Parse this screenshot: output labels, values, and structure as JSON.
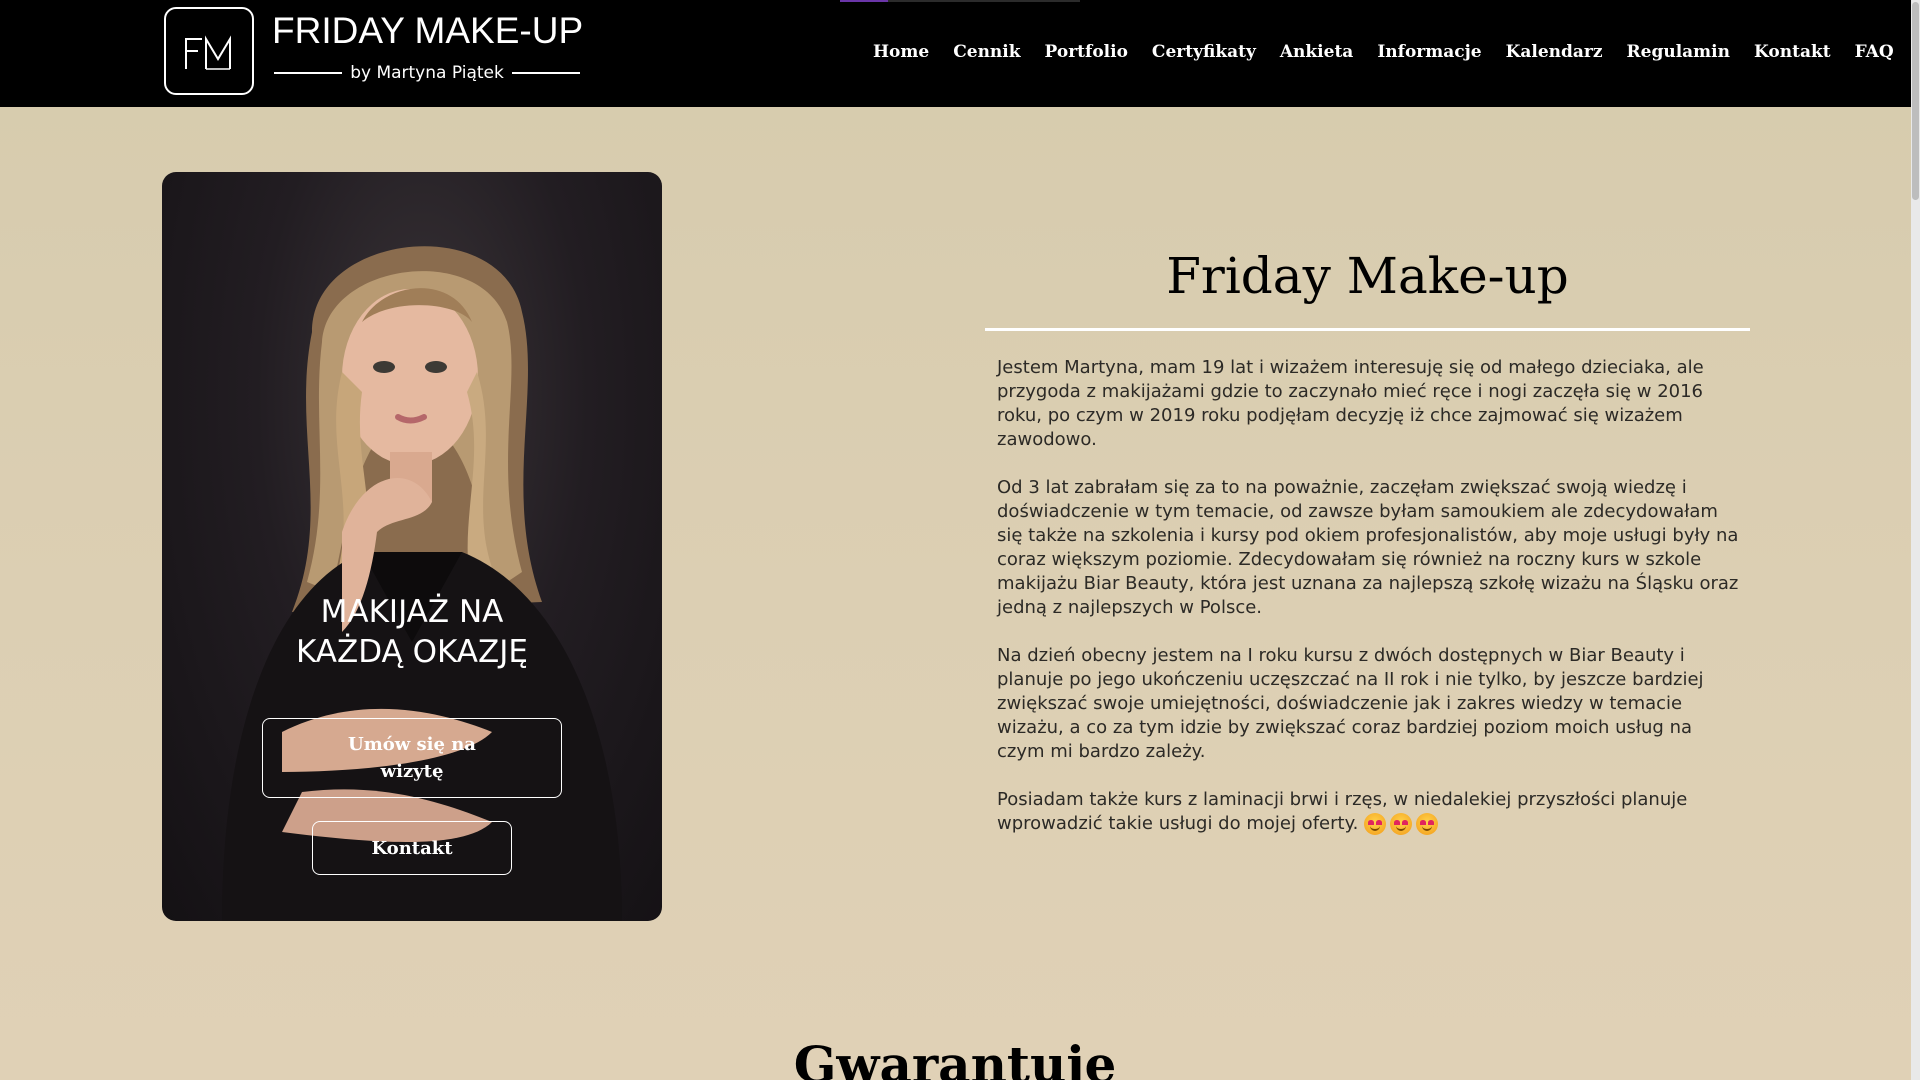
{
  "header": {
    "logo_letters": "FM",
    "brand_title": "FRIDAY MAKE-UP",
    "brand_subtitle": "by Martyna Piątek",
    "nav": [
      {
        "label": "Home"
      },
      {
        "label": "Cennik"
      },
      {
        "label": "Portfolio"
      },
      {
        "label": "Certyfikaty"
      },
      {
        "label": "Ankieta"
      },
      {
        "label": "Informacje"
      },
      {
        "label": "Kalendarz"
      },
      {
        "label": "Regulamin"
      },
      {
        "label": "Kontakt"
      },
      {
        "label": "FAQ"
      }
    ]
  },
  "hero": {
    "heading_line1": "MAKIJAŻ NA",
    "heading_line2": "KAŻDĄ OKAZJĘ",
    "appointment_button": "Umów się na wizytę",
    "contact_button": "Kontakt"
  },
  "about": {
    "title": "Friday Make-up",
    "paragraphs": [
      "Jestem Martyna, mam 19 lat i wizażem interesuję się od małego dzieciaka, ale przygoda z makijażami gdzie to zaczynało mieć ręce i nogi zaczęła się w 2016 roku, po czym w 2019 roku podjęłam decyzję iż chce zajmować się wizażem zawodowo.",
      "Od 3 lat zabrałam się za to na poważnie, zaczęłam zwiększać swoją wiedzę i doświadczenie w tym temacie, od zawsze byłam samoukiem ale zdecydowałam się także na szkolenia i kursy pod okiem profesjonalistów, aby moje usługi były na coraz większym poziomie. Zdecydowałam się również na roczny kurs w szkole makijażu Biar Beauty, która jest uznana za najlepszą szkołę wizażu na Śląsku oraz jedną z najlepszych w Polsce.",
      "Na dzień obecny jestem na I roku kursu z dwóch dostępnych w Biar Beauty i planuje po jego ukończeniu uczęszczać na II rok i nie tylko, by jeszcze bardziej zwiększać swoje umiejętności, doświadczenie jak i zakres wiedzy w temacie wizażu, a co za tym idzie by zwiększać coraz bardziej poziom moich usług na czym mi bardzo zależy.",
      "Posiadam także kurs z laminacji brwi i rzęs, w niedalekiej przyszłości planuje wprowadzić takie usługi do mojej oferty."
    ],
    "emoji": [
      "smiling-face-with-hearts-icon",
      "smiling-face-with-hearts-icon",
      "smiling-face-with-hearts-icon"
    ]
  },
  "next_section": {
    "heading": "Gwarantuje"
  }
}
